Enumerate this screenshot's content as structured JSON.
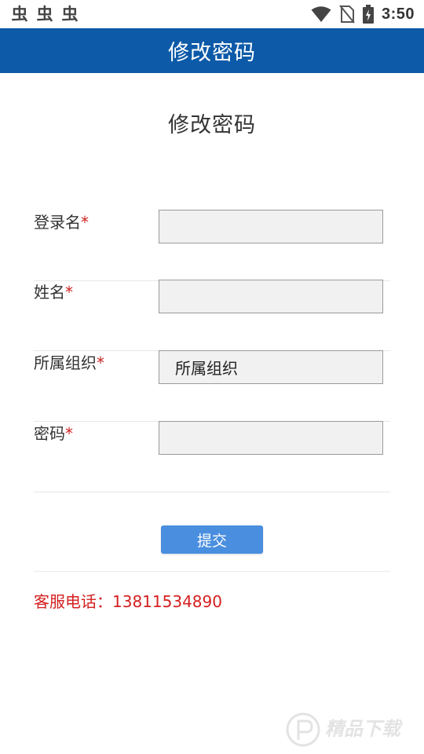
{
  "status_bar": {
    "notification_icons": [
      "虫",
      "虫",
      "虫"
    ],
    "time": "3:50"
  },
  "header": {
    "title": "修改密码"
  },
  "page": {
    "title": "修改密码"
  },
  "form": {
    "required_mark": "*",
    "fields": [
      {
        "label": "登录名",
        "value": ""
      },
      {
        "label": "姓名",
        "value": ""
      },
      {
        "label": "所属组织",
        "value": "所属组织"
      },
      {
        "label": "密码",
        "value": ""
      }
    ]
  },
  "submit_label": "提交",
  "hotline": "客服电话：13811534890",
  "colors": {
    "header_bg": "#0c5aa8",
    "button_bg": "#4a8edf",
    "required": "#cc2222",
    "hotline": "#d42020"
  },
  "watermark": {
    "text": "精品下载"
  }
}
